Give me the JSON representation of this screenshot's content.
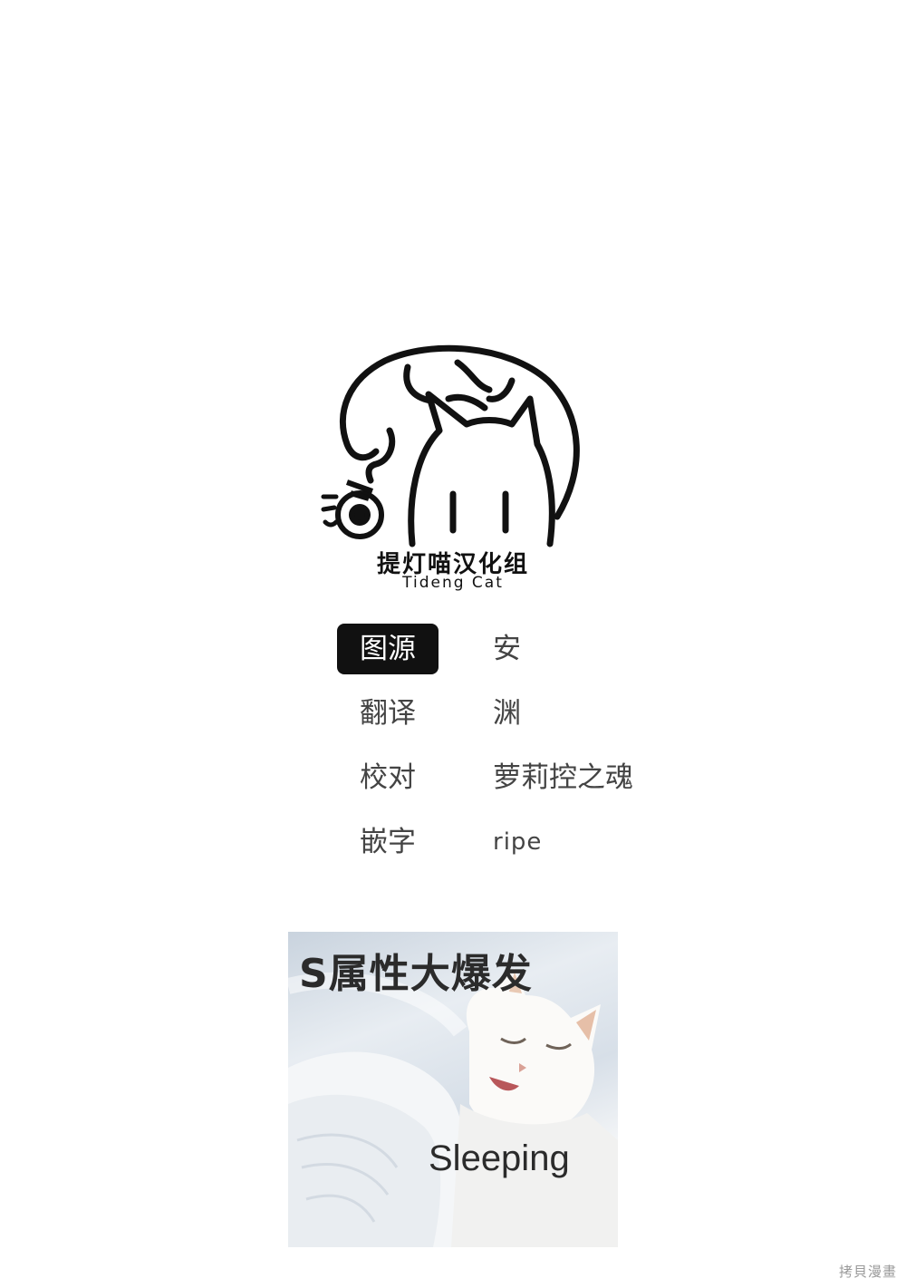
{
  "logo": {
    "title": "提灯喵汉化组",
    "subtitle": "Tideng Cat"
  },
  "credits": [
    {
      "role": "图源",
      "name": "安",
      "highlighted": true
    },
    {
      "role": "翻译",
      "name": "渊",
      "highlighted": false
    },
    {
      "role": "校对",
      "name": "萝莉控之魂",
      "highlighted": false
    },
    {
      "role": "嵌字",
      "name": "ripe",
      "highlighted": false
    }
  ],
  "meme": {
    "caption": "S属性大爆发",
    "sub_caption": "Sleeping"
  },
  "watermark": "拷貝漫畫"
}
